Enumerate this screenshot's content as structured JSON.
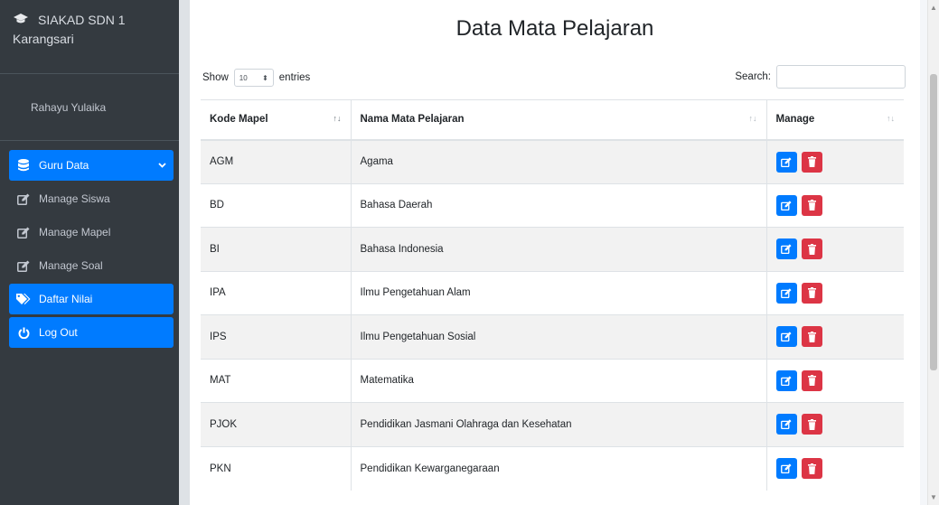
{
  "sidebar": {
    "brand": "SIAKAD SDN 1 Karangsari",
    "user_name": "Rahayu Yulaika",
    "items": [
      {
        "label": "Guru Data",
        "icon": "database-icon",
        "active": true
      },
      {
        "label": "Manage Siswa",
        "icon": "edit-icon",
        "active": false
      },
      {
        "label": "Manage Mapel",
        "icon": "edit-icon",
        "active": false
      },
      {
        "label": "Manage Soal",
        "icon": "edit-icon",
        "active": false
      },
      {
        "label": "Daftar Nilai",
        "icon": "tags-icon",
        "active": true
      },
      {
        "label": "Log Out",
        "icon": "power-icon",
        "active": true
      }
    ]
  },
  "main": {
    "title": "Data Mata Pelajaran",
    "show_label": "Show",
    "entries_value": "10",
    "entries_label": "entries",
    "search_label": "Search:",
    "search_value": ""
  },
  "table": {
    "headers": [
      "Kode Mapel",
      "Nama Mata Pelajaran",
      "Manage"
    ],
    "rows": [
      {
        "kode": "AGM",
        "nama": "Agama"
      },
      {
        "kode": "BD",
        "nama": "Bahasa Daerah"
      },
      {
        "kode": "BI",
        "nama": "Bahasa Indonesia"
      },
      {
        "kode": "IPA",
        "nama": "Ilmu Pengetahuan Alam"
      },
      {
        "kode": "IPS",
        "nama": "Ilmu Pengetahuan Sosial"
      },
      {
        "kode": "MAT",
        "nama": "Matematika"
      },
      {
        "kode": "PJOK",
        "nama": "Pendidikan Jasmani Olahraga dan Kesehatan"
      },
      {
        "kode": "PKN",
        "nama": "Pendidikan Kewarganegaraan"
      }
    ]
  },
  "colors": {
    "sidebar_bg": "#343a40",
    "primary": "#007bff",
    "danger": "#dc3545"
  }
}
